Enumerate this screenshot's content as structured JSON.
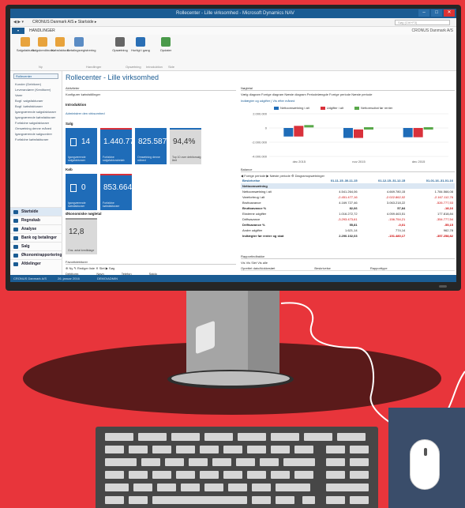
{
  "window": {
    "title": "Rollecenter - Lille virksomhed - Microsoft Dynamics NAV",
    "buttons": [
      "–",
      "□",
      "✕"
    ]
  },
  "address": {
    "nav": "◀ ▶ ▾",
    "path": "CRONUS Danmark A/S  ▸  Startside  ▸",
    "search_placeholder": "Søg (Ctrl+F3)"
  },
  "menubar": {
    "file": "▾",
    "tab": "HANDLINGER",
    "company": "CRONUS Danmark A/S"
  },
  "ribbon": {
    "buttons": [
      {
        "label": "Salgsfaktura",
        "color": "#e8a33c"
      },
      {
        "label": "Salgskreditnota",
        "color": "#e8a33c"
      },
      {
        "label": "Købsfaktura",
        "color": "#e8a33c"
      },
      {
        "label": "Betalingsregistrering",
        "color": "#5b8cc4"
      },
      {
        "label": "Opsætning",
        "color": "#666666"
      },
      {
        "label": "Hurtigt i gang",
        "color": "#2a6fb5"
      },
      {
        "label": "Opdater",
        "color": "#4a9a4a"
      }
    ],
    "groups": [
      "Ny",
      "Handlinger",
      "Opsætning",
      "Introduktion",
      "Side"
    ]
  },
  "sidebar": {
    "header": "Rollecenter",
    "items": [
      "Kunder (Debitorer)",
      "Leverandører (Kreditorer)",
      "Varer",
      "Bogf. salgsfakturaer",
      "Bogf. købsfakturaer",
      "Igangværende salgsfakturaer",
      "Igangværende købsfakturaer",
      "Forfaldne salgsfakturaer",
      "Omsætning denne måned",
      "Igangværende salgsordrer",
      "Forfaldne købsfakturaer"
    ],
    "nav": [
      {
        "label": "Startside",
        "active": true
      },
      {
        "label": "Regnskab",
        "active": false
      },
      {
        "label": "Analyse",
        "active": false
      },
      {
        "label": "Bank og betalinger",
        "active": false
      },
      {
        "label": "Salg",
        "active": false
      },
      {
        "label": "Økonomirapportering",
        "active": false
      },
      {
        "label": "Afdelinger",
        "active": false
      }
    ]
  },
  "statusbar": {
    "company": "CRONUS Danmark A/S",
    "date": "26. januar 2016",
    "user": "DEMO\\ADMIN"
  },
  "main": {
    "title": "Rollecenter - Lille virksomhed",
    "activities_header": "Aktiviteter",
    "configure_link": "Konfigurer køindstillinger",
    "intro_header": "Introduktion",
    "intro_link": "Administrer den virksomhed",
    "sales_header": "Salg",
    "purchase_header": "Køb",
    "economy_header": "Økonomiske nøgletal",
    "sales_tiles": [
      {
        "value": "14",
        "label": "Igangværende salgsfakturaer",
        "bar": "#1f6cb8",
        "grey": false,
        "doc": true
      },
      {
        "value": "1.440.773",
        "label": "Forfaldne salgsfakturabeløb",
        "bar": "#d9313b",
        "grey": false,
        "doc": false
      },
      {
        "value": "825.587",
        "label": "Omsætning denne måned",
        "bar": "#1f6cb8",
        "grey": false,
        "doc": false
      },
      {
        "value": "94,4%",
        "label": "Top 10 over debitorsalg året",
        "bar": "#1f6cb8",
        "grey": true,
        "doc": false
      }
    ],
    "purchase_tiles": [
      {
        "value": "0",
        "label": "Igangværende købsfakturaer",
        "bar": "#1f6cb8",
        "grey": false,
        "doc": true
      },
      {
        "value": "853.664",
        "label": "Forfaldne købsfakturaer",
        "bar": "#d9313b",
        "grey": false,
        "doc": false
      }
    ],
    "economy_tiles": [
      {
        "value": "12,8",
        "label": "Gns. antal kreditdage",
        "bar": "#999999",
        "grey": true,
        "doc": false
      }
    ],
    "favorites_header": "Favoritdebitorer",
    "favorites_actions": "⊕ Ny  ✎ Rediger liste  ✕ Slet  ▶ Søg",
    "favorites_cols": [
      "Debitornr.",
      "Navn",
      "Telefon",
      "Saldo"
    ]
  },
  "chart": {
    "header": "Nøgletal",
    "actions": "Vælg diagram  Forrige diagram  Næste diagram  Periodelængde  Forrige periode  Næste periode",
    "title": "Indtægter og udgifter | Vis efter måned",
    "legend": [
      {
        "name": "Nettoomsætning i alt",
        "color": "#1f6cb8"
      },
      {
        "name": "Udgifter i alt",
        "color": "#d9313b"
      },
      {
        "name": "Nettoresultat før renter",
        "color": "#59a84a"
      }
    ],
    "yticks": [
      "2.000.000",
      "0",
      "-2.000.000",
      "-4.000.000"
    ]
  },
  "chart_data": {
    "type": "bar",
    "categories": [
      "dec 2015",
      "nov 2015",
      "dec 2015"
    ],
    "series": [
      {
        "name": "Nettoomsætning i alt",
        "values": [
          -1200000,
          -1400000,
          -1300000
        ]
      },
      {
        "name": "Udgifter i alt",
        "values": [
          1500000,
          1200000,
          1300000
        ]
      },
      {
        "name": "Nettoresultat før renter",
        "values": [
          300000,
          -200000,
          0
        ]
      }
    ],
    "ylim": [
      -4000000,
      2000000
    ]
  },
  "balance": {
    "header": "Balance",
    "actions": "◀ Forrige periode  ▶ Næste periode  ⚙ Diagramopsætninger",
    "columns": [
      "Beskrivelse",
      "01-11-15..30-11-15",
      "01-12-15..31-12-15",
      "01-01-16..31-01-16"
    ],
    "rows": [
      {
        "cells": [
          "Nettoomsætning",
          "",
          "",
          ""
        ],
        "bold": true,
        "hl": true
      },
      {
        "cells": [
          "Nettoomsætning i alt",
          "4.541.264,06",
          "4.669.780,15",
          "1.784.566,08"
        ],
        "bold": false,
        "hl": false
      },
      {
        "cells": [
          "Vareforbrug i alt",
          "-2.451.477,16",
          "-2.022.862,02",
          "-2.167.112,76"
        ],
        "bold": false,
        "hl": false
      },
      {
        "cells": [
          "Bruttoavance",
          "4.169.727,46",
          "3.063.218,22",
          "-526.777,53"
        ],
        "bold": false,
        "hl": false
      },
      {
        "cells": [
          "Bruttoavance %",
          "82,66",
          "57,84",
          "-18,16"
        ],
        "bold": true,
        "hl": false
      },
      {
        "cells": [
          "Eksterne udgifter",
          "1.016.272,72",
          "4.059.463,51",
          "177.818,84"
        ],
        "bold": false,
        "hl": false
      },
      {
        "cells": [
          "Driftsavance",
          "-3.293.473,61",
          "-156.754,21",
          "-354.777,54"
        ],
        "bold": false,
        "hl": false
      },
      {
        "cells": [
          "Driftsavance %",
          "55,81",
          "-0,01",
          "-55,15"
        ],
        "bold": true,
        "hl": false
      },
      {
        "cells": [
          "Andre udgifter",
          "1.621,14",
          "774,14",
          "962,78"
        ],
        "bold": false,
        "hl": false
      },
      {
        "cells": [
          "Indtægter før renter og skat",
          "2.290.102,03",
          "-151.480,17",
          "-357.258,82"
        ],
        "bold": true,
        "hl": false
      }
    ]
  },
  "reports": {
    "header": "Rapportindbakke",
    "actions": "Vis  Vis  Slet  Vis alle",
    "cols": [
      "Oprettet dato/klokkeslæt",
      "Beskrivelse",
      "Rapporttype"
    ]
  }
}
